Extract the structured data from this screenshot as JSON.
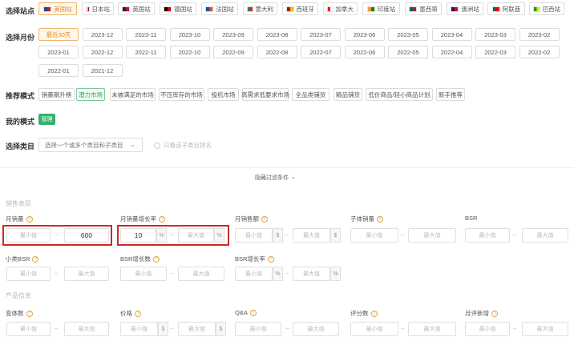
{
  "labels": {
    "site": "选择站点",
    "month": "选择月份",
    "recommend": "推荐模式",
    "mine": "我的模式",
    "category": "选择类目"
  },
  "sites": [
    {
      "label": "美国站",
      "colors": [
        "#3c3b6e",
        "#b22234"
      ]
    },
    {
      "label": "日本站",
      "colors": [
        "#ffffff",
        "#bc002d"
      ]
    },
    {
      "label": "英国站",
      "colors": [
        "#012169",
        "#c8102e"
      ]
    },
    {
      "label": "德国站",
      "colors": [
        "#000000",
        "#dd0000"
      ]
    },
    {
      "label": "法国站",
      "colors": [
        "#0055a4",
        "#ef4135"
      ]
    },
    {
      "label": "意大利",
      "colors": [
        "#009246",
        "#ce2b37"
      ]
    },
    {
      "label": "西班牙",
      "colors": [
        "#aa151b",
        "#f1bf00"
      ]
    },
    {
      "label": "加拿大",
      "colors": [
        "#ff0000",
        "#ffffff"
      ]
    },
    {
      "label": "印度站",
      "colors": [
        "#ff9933",
        "#138808"
      ]
    },
    {
      "label": "墨西哥",
      "colors": [
        "#006847",
        "#ce1126"
      ]
    },
    {
      "label": "澳洲站",
      "colors": [
        "#012169",
        "#e4002b"
      ]
    },
    {
      "label": "阿联酋",
      "colors": [
        "#00732f",
        "#ff0000"
      ]
    },
    {
      "label": "巴西站",
      "colors": [
        "#009c3b",
        "#ffdf00"
      ]
    }
  ],
  "months": [
    "最近30天",
    "2023-12",
    "2023-11",
    "2023-10",
    "2023-09",
    "2023-08",
    "2023-07",
    "2023-06",
    "2023-05",
    "2023-04",
    "2023-03",
    "2023-02",
    "2023-01",
    "2022-12",
    "2022-11",
    "2022-10",
    "2022-09",
    "2022-08",
    "2022-07",
    "2022-06",
    "2022-05",
    "2022-04",
    "2022-03",
    "2022-02",
    "2022-01",
    "2021-12"
  ],
  "modes": [
    "销量飙升榜",
    "潜力市场",
    "未被满足的市场",
    "不压库存的市场",
    "投机市场",
    "高需求低要求市场",
    "全品类铺货",
    "精品铺货",
    "低价商品/轻小商品计划",
    "新手推荐"
  ],
  "my_mode_button": "管理",
  "category": {
    "placeholder": "选择一个或多个类目和子类目",
    "only_sub": "只看该子类目排名"
  },
  "toggle_label": "隐藏过滤条件",
  "sections": {
    "sales": "销售表现",
    "product": "产品信息"
  },
  "fields": {
    "monthly_sales": "月销量",
    "monthly_sales_growth": "月销量增长率",
    "monthly_revenue": "月销售额",
    "sub_sales": "子体销量",
    "bsr": "BSR",
    "sub_bsr": "小类BSR",
    "bsr_growth_count": "BSR增长数",
    "bsr_growth_rate": "BSR增长率",
    "variant_count": "变体数",
    "price": "价格",
    "qa": "Q&A",
    "review_count": "评分数",
    "monthly_new_reviews": "月评新增"
  },
  "ph": {
    "min": "最小值",
    "max": "最大值"
  },
  "values": {
    "monthly_sales_max": "600",
    "growth_min": "10"
  },
  "units": {
    "pct": "%",
    "usd": "$"
  },
  "colors": {
    "accent": "#e08a1e",
    "green": "#33b36b",
    "highlight": "#c92a2a"
  }
}
